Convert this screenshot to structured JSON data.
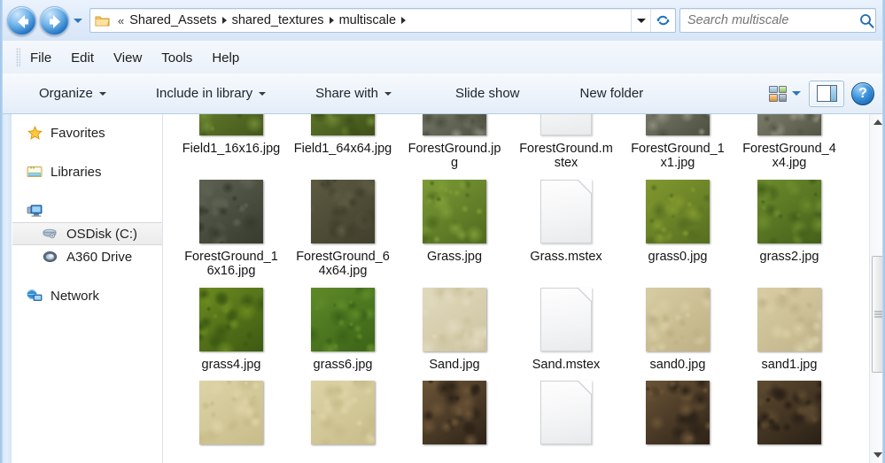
{
  "window": {
    "title": "multiscale"
  },
  "navbar": {
    "back_label": "Back",
    "forward_label": "Forward",
    "recent_pages_label": "Recent Pages",
    "folder_icon": "folder-icon",
    "overflow_chevron": "«",
    "breadcrumbs": [
      {
        "label": "Shared_Assets"
      },
      {
        "label": "shared_textures"
      },
      {
        "label": "multiscale"
      }
    ],
    "address_dropdown_label": "Previous Locations",
    "refresh_label": "Refresh",
    "search": {
      "placeholder": "Search multiscale",
      "value": "",
      "icon": "search-icon"
    }
  },
  "menubar": {
    "items": [
      {
        "label": "File"
      },
      {
        "label": "Edit"
      },
      {
        "label": "View"
      },
      {
        "label": "Tools"
      },
      {
        "label": "Help"
      }
    ]
  },
  "toolbar": {
    "organize_label": "Organize",
    "include_label": "Include in library",
    "share_label": "Share with",
    "slideshow_label": "Slide show",
    "newfolder_label": "New folder",
    "views_label": "Change your view",
    "preview_label": "Show the preview pane",
    "help_label": "?"
  },
  "navpane": {
    "items": [
      {
        "label": "Favorites",
        "icon": "star-icon",
        "level": 0,
        "selected": false
      },
      {
        "label": "Libraries",
        "icon": "libraries-icon",
        "level": 0,
        "selected": false
      },
      {
        "label": "",
        "icon": "computer-icon",
        "level": 0,
        "selected": false
      },
      {
        "label": "OSDisk (C:)",
        "icon": "harddisk-icon",
        "level": 1,
        "selected": true
      },
      {
        "label": "A360 Drive",
        "icon": "a360-icon",
        "level": 1,
        "selected": false
      },
      {
        "label": "Network",
        "icon": "network-icon",
        "level": 0,
        "selected": false
      }
    ]
  },
  "filegrid": {
    "view": "Large icons",
    "files": [
      {
        "name": "Field1_16x16.jpg",
        "kind": "image",
        "color_a": "#6f8a33",
        "color_b": "#44571c",
        "partial_top": true
      },
      {
        "name": "Field1_64x64.jpg",
        "kind": "image",
        "color_a": "#6e8733",
        "color_b": "#3f5119",
        "partial_top": true
      },
      {
        "name": "ForestGround.jpg",
        "kind": "image",
        "color_a": "#8e8d7e",
        "color_b": "#4d5141",
        "partial_top": true
      },
      {
        "name": "ForestGround.mstex",
        "kind": "document",
        "color_a": "#f2f3f4",
        "color_b": "#e4e5e7",
        "partial_top": true
      },
      {
        "name": "ForestGround_1x1.jpg",
        "kind": "image",
        "color_a": "#8d8c7d",
        "color_b": "#4c5040",
        "partial_top": true
      },
      {
        "name": "ForestGround_4x4.jpg",
        "kind": "image",
        "color_a": "#93917f",
        "color_b": "#545646",
        "partial_top": true
      },
      {
        "name": "ForestGround_16x16.jpg",
        "kind": "image",
        "color_a": "#5d6152",
        "color_b": "#373b2d",
        "partial_top": false
      },
      {
        "name": "ForestGround_64x64.jpg",
        "kind": "image",
        "color_a": "#5d5a42",
        "color_b": "#41402c",
        "partial_top": false
      },
      {
        "name": "Grass.jpg",
        "kind": "image",
        "color_a": "#7d9b36",
        "color_b": "#4e6a1e",
        "partial_top": false
      },
      {
        "name": "Grass.mstex",
        "kind": "document",
        "color_a": "#f2f3f4",
        "color_b": "#e4e5e7",
        "partial_top": false
      },
      {
        "name": "grass0.jpg",
        "kind": "image",
        "color_a": "#82982f",
        "color_b": "#566f20",
        "partial_top": false
      },
      {
        "name": "grass2.jpg",
        "kind": "image",
        "color_a": "#6d8b2c",
        "color_b": "#44611a",
        "partial_top": false
      },
      {
        "name": "grass4.jpg",
        "kind": "image",
        "color_a": "#6b8a1f",
        "color_b": "#3d5a12",
        "partial_top": false
      },
      {
        "name": "grass6.jpg",
        "kind": "image",
        "color_a": "#5f8a28",
        "color_b": "#3b6317",
        "partial_top": false
      },
      {
        "name": "Sand.jpg",
        "kind": "image",
        "color_a": "#e0d9bd",
        "color_b": "#cdc49f",
        "partial_top": false
      },
      {
        "name": "Sand.mstex",
        "kind": "document",
        "color_a": "#f2f3f4",
        "color_b": "#e4e5e7",
        "partial_top": false
      },
      {
        "name": "sand0.jpg",
        "kind": "image",
        "color_a": "#d6cba2",
        "color_b": "#bfb184",
        "partial_top": false
      },
      {
        "name": "sand1.jpg",
        "kind": "image",
        "color_a": "#d8cda4",
        "color_b": "#c2b489",
        "partial_top": false
      },
      {
        "name": "",
        "kind": "image",
        "color_a": "#ddd3a6",
        "color_b": "#c8bc8a",
        "partial_top": false
      },
      {
        "name": "",
        "kind": "image",
        "color_a": "#ddd3a6",
        "color_b": "#c8bc8a",
        "partial_top": false
      },
      {
        "name": "",
        "kind": "image",
        "color_a": "#6b5436",
        "color_b": "#2e2318",
        "partial_top": false
      },
      {
        "name": "",
        "kind": "document",
        "color_a": "#f2f3f4",
        "color_b": "#e4e5e7",
        "partial_top": false
      },
      {
        "name": "",
        "kind": "image",
        "color_a": "#6b5436",
        "color_b": "#2e2318",
        "partial_top": false
      },
      {
        "name": "",
        "kind": "image",
        "color_a": "#5d4a30",
        "color_b": "#2a2016",
        "partial_top": false
      }
    ]
  },
  "scrollbar": {
    "up_label": "Scroll up",
    "down_label": "Scroll down",
    "thumb_label": "Vertical scroll thumb"
  },
  "colors": {
    "accent": "#2c77bd",
    "frame": "#bcd8f2",
    "pane_bg": "#ffffff",
    "selection": "#ebebeb"
  }
}
